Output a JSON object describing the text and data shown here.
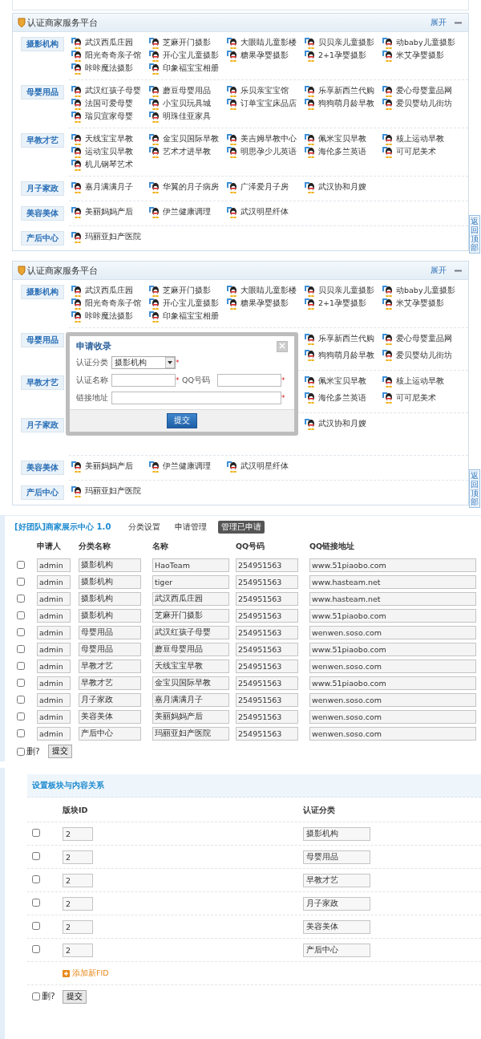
{
  "platform_panels": [
    {
      "title": "认证商家服务平台",
      "toggle_label": "展开",
      "back_top": "返回顶部",
      "categories": [
        {
          "name": "摄影机构",
          "covered": false,
          "items": [
            "武汉西瓜庄园",
            "芝麻开门摄影",
            "大眼睛儿童影楼",
            "贝贝亲儿童摄影",
            "动baby儿童摄影",
            "阳光奇奇亲子馆",
            "开心宝儿童摄影",
            "糖果孕婴摄影",
            "2+1孕婴摄影",
            "米艾孕婴摄影",
            "咔咔魔法摄影",
            "印象福宝宝相册"
          ]
        },
        {
          "name": "母婴用品",
          "covered": false,
          "items": [
            "武汉红孩子母婴",
            "蘑豆母婴用品",
            "乐贝亲宝宝馆",
            "乐享新西兰代购",
            "爱心母婴童品网",
            "法国可爱母婴",
            "小宝贝玩具城",
            "订单宝宝床品店",
            "狗狗萌月龄早教",
            "爱贝婴幼儿街坊",
            "瑞贝宜家母婴",
            "明珠佳亚家具"
          ]
        },
        {
          "name": "早教才艺",
          "covered": false,
          "items": [
            "天线宝宝早教",
            "金宝贝国际早教",
            "美吉姆早教中心",
            "佩米宝贝早教",
            "核上运动早教",
            "运动宝贝早教",
            "艺术才进早教",
            "明思孕少儿英语",
            "海伦多兰英语",
            "可可尼美术",
            "机儿钢琴艺术"
          ]
        },
        {
          "name": "月子家政",
          "covered": false,
          "items": [
            "嘉月满满月子",
            "华翼的月子病房",
            "广泽爱月子房",
            "武汉协和月嫂"
          ]
        },
        {
          "name": "美容美体",
          "covered": false,
          "items": [
            "美丽妈妈产后",
            "伊兰健康调理",
            "武汉明星纤体"
          ]
        },
        {
          "name": "产后中心",
          "covered": false,
          "items": [
            "玛丽亚妇产医院"
          ]
        }
      ]
    },
    {
      "title": "认证商家服务平台",
      "toggle_label": "展开",
      "back_top": "返回顶部",
      "categories": [
        {
          "name": "摄影机构",
          "covered": false,
          "items": [
            "武汉西瓜庄园",
            "芝麻开门摄影",
            "大眼睛儿童影楼",
            "贝贝亲儿童摄影",
            "动baby儿童摄影",
            "阳光奇奇亲子馆",
            "开心宝儿童摄影",
            "糖果孕婴摄影",
            "2+1孕婴摄影",
            "米艾孕婴摄影",
            "咔咔魔法摄影",
            "印象福宝宝相册"
          ]
        },
        {
          "name": "母婴用品",
          "covered": true,
          "items": [
            "乐享新西兰代购",
            "爱心母婴童品网",
            "狗狗萌月龄早教",
            "爱贝婴幼儿街坊"
          ]
        },
        {
          "name": "早教才艺",
          "covered": true,
          "items": [
            "佩米宝贝早教",
            "核上运动早教",
            "海伦多兰英语",
            "可可尼美术"
          ]
        },
        {
          "name": "月子家政",
          "covered": true,
          "items": [
            "武汉协和月嫂"
          ]
        },
        {
          "name": "美容美体",
          "covered": false,
          "items": [
            "美丽妈妈产后",
            "伊兰健康调理",
            "武汉明星纤体"
          ]
        },
        {
          "name": "产后中心",
          "covered": false,
          "items": [
            "玛丽亚妇产医院"
          ]
        }
      ],
      "dialog": {
        "title": "申请收录",
        "submit": "提交",
        "required_mark": "*",
        "fields": [
          {
            "kind": "select",
            "label": "认证分类",
            "value": "摄影机构",
            "required": true
          },
          {
            "kind": "text",
            "label": "认证名称",
            "required": true
          },
          {
            "kind": "text",
            "label": "QQ号码",
            "required": true
          },
          {
            "kind": "long",
            "label": "链接地址",
            "required": true
          }
        ]
      }
    }
  ],
  "admin": {
    "title": "[好团队]商家展示中心 1.0",
    "tabs": [
      {
        "label": "分类设置",
        "selected": false
      },
      {
        "label": "申请管理",
        "selected": false
      },
      {
        "label": "管理已申请",
        "selected": true
      }
    ],
    "columns": [
      "申请人",
      "分类名称",
      "名称",
      "QQ号码",
      "QQ链接地址"
    ],
    "rows": [
      {
        "checked": false,
        "applicant": "admin",
        "category": "摄影机构",
        "name": "HaoTeam",
        "qq": "254951563",
        "link": "www.51piaobo.com"
      },
      {
        "checked": false,
        "applicant": "admin",
        "category": "摄影机构",
        "name": "tiger",
        "qq": "254951563",
        "link": "www.hasteam.net"
      },
      {
        "checked": false,
        "applicant": "admin",
        "category": "摄影机构",
        "name": "武汉西瓜庄园",
        "qq": "254951563",
        "link": "www.hasteam.net"
      },
      {
        "checked": false,
        "applicant": "admin",
        "category": "摄影机构",
        "name": "芝麻开门摄影",
        "qq": "254951563",
        "link": "www.51piaobo.com"
      },
      {
        "checked": false,
        "applicant": "admin",
        "category": "母婴用品",
        "name": "武汉红孩子母婴",
        "qq": "254951563",
        "link": "wenwen.soso.com"
      },
      {
        "checked": false,
        "applicant": "admin",
        "category": "母婴用品",
        "name": "蘑豆母婴用品",
        "qq": "254951563",
        "link": "www.51piaobo.com"
      },
      {
        "checked": false,
        "applicant": "admin",
        "category": "早教才艺",
        "name": "天线宝宝早教",
        "qq": "254951563",
        "link": "wenwen.soso.com"
      },
      {
        "checked": false,
        "applicant": "admin",
        "category": "早教才艺",
        "name": "金宝贝国际早教",
        "qq": "254951563",
        "link": "www.51piaobo.com"
      },
      {
        "checked": false,
        "applicant": "admin",
        "category": "月子家政",
        "name": "嘉月满满月子",
        "qq": "254951563",
        "link": "wenwen.soso.com"
      },
      {
        "checked": false,
        "applicant": "admin",
        "category": "美容美体",
        "name": "美丽妈妈产后",
        "qq": "254951563",
        "link": "wenwen.soso.com"
      },
      {
        "checked": false,
        "applicant": "admin",
        "category": "产后中心",
        "name": "玛丽亚妇产医院",
        "qq": "254951563",
        "link": "wenwen.soso.com"
      }
    ],
    "delete_label": "删?",
    "delete_checked": false,
    "submit": "提交"
  },
  "fid_settings": {
    "title": "设置板块与内容关系",
    "columns": [
      "版块ID",
      "认证分类"
    ],
    "rows": [
      {
        "checked": false,
        "fid": "2",
        "category": "摄影机构"
      },
      {
        "checked": false,
        "fid": "2",
        "category": "母婴用品"
      },
      {
        "checked": false,
        "fid": "2",
        "category": "早教才艺"
      },
      {
        "checked": false,
        "fid": "2",
        "category": "月子家政"
      },
      {
        "checked": false,
        "fid": "2",
        "category": "美容美体"
      },
      {
        "checked": false,
        "fid": "2",
        "category": "产后中心"
      }
    ],
    "add_label": "添加新FID",
    "delete_label": "删?",
    "delete_checked": false,
    "submit": "提交"
  }
}
